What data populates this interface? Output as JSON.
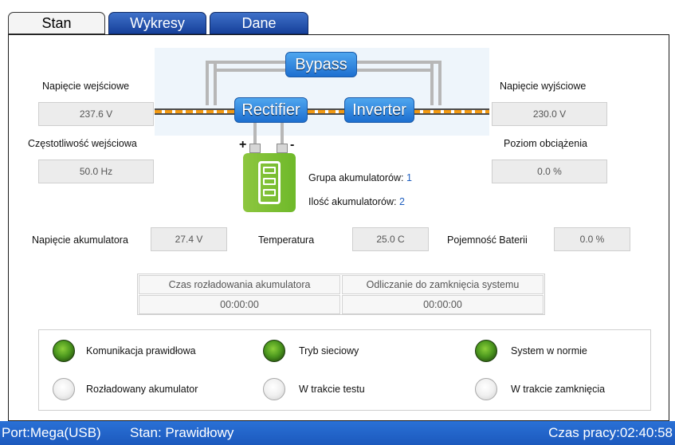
{
  "tabs": [
    {
      "label": "Stan",
      "active": true
    },
    {
      "label": "Wykresy",
      "active": false
    },
    {
      "label": "Dane",
      "active": false
    }
  ],
  "diagram": {
    "bypass": "Bypass",
    "rectifier": "Rectifier",
    "inverter": "Inverter",
    "plus": "+",
    "minus": "-"
  },
  "input": {
    "voltage_label": "Napięcie wejściowe",
    "voltage_value": "237.6 V",
    "frequency_label": "Częstotliwość wejściowa",
    "frequency_value": "50.0 Hz"
  },
  "output": {
    "voltage_label": "Napięcie wyjściowe",
    "voltage_value": "230.0 V",
    "load_label": "Poziom obciążenia",
    "load_value": "0.0 %"
  },
  "battery": {
    "group_label": "Grupa akumulatorów:",
    "group_value": "1",
    "count_label": "Ilość akumulatorów:",
    "count_value": "2",
    "voltage_label": "Napięcie akumulatora",
    "voltage_value": "27.4 V",
    "temperature_label": "Temperatura",
    "temperature_value": "25.0 C",
    "capacity_label": "Pojemność Baterii",
    "capacity_value": "0.0 %"
  },
  "timers": {
    "discharge_label": "Czas rozładowania akumulatora",
    "discharge_value": "00:00:00",
    "shutdown_label": "Odliczanie do zamknięcia systemu",
    "shutdown_value": "00:00:00"
  },
  "indicators": [
    {
      "label": "Komunikacja prawidłowa",
      "state": "on"
    },
    {
      "label": "Tryb sieciowy",
      "state": "on"
    },
    {
      "label": "System w normie",
      "state": "on"
    },
    {
      "label": "Rozładowany akumulator",
      "state": "off"
    },
    {
      "label": "W trakcie testu",
      "state": "off"
    },
    {
      "label": "W trakcie zamknięcia",
      "state": "off"
    }
  ],
  "statusbar": {
    "port": "Port:Mega(USB)",
    "state": "Stan: Prawidłowy",
    "uptime": "Czas pracy:02:40:58"
  },
  "colors": {
    "accent_blue": "#1c59bd",
    "led_on": "#4e9a1f",
    "led_off": "#f0f0f0",
    "power_line": "#f39a12",
    "battery": "#8dc63f"
  }
}
